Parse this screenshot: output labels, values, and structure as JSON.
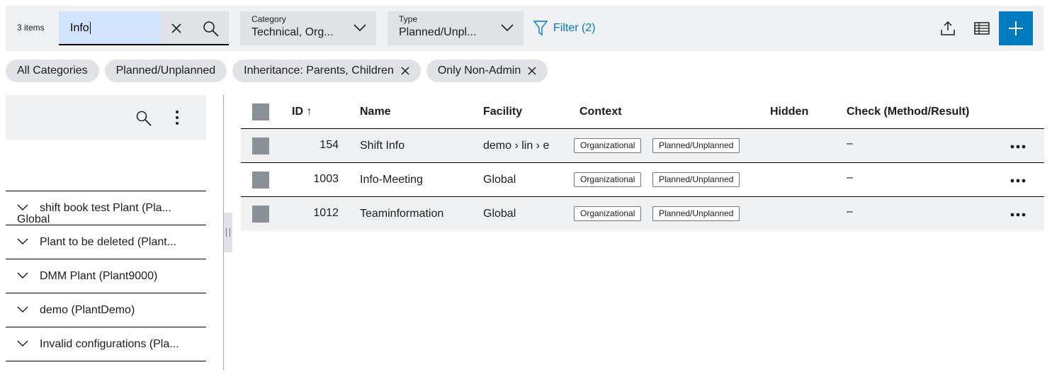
{
  "toolbar": {
    "items_count": "3 items",
    "search": {
      "value": "Info"
    },
    "category": {
      "label": "Category",
      "value": "Technical, Org..."
    },
    "type": {
      "label": "Type",
      "value": "Planned/Unpl..."
    },
    "filter_label": "Filter (2)",
    "accent_color": "#007bc0"
  },
  "chips": [
    {
      "label": "All Categories",
      "removable": false
    },
    {
      "label": "Planned/Unplanned",
      "removable": false
    },
    {
      "label": "Inheritance: Parents, Children",
      "removable": true
    },
    {
      "label": "Only Non-Admin",
      "removable": true
    }
  ],
  "left_panel": {
    "global_label": "Global",
    "items": [
      {
        "label": "shift book test Plant (Pla..."
      },
      {
        "label": "Plant to be deleted (Plant..."
      },
      {
        "label": "DMM Plant (Plant9000)"
      },
      {
        "label": "demo (PlantDemo)"
      },
      {
        "label": "Invalid configurations (Pla..."
      }
    ]
  },
  "table": {
    "columns": {
      "id": "ID",
      "id_sort": "↑",
      "name": "Name",
      "facility": "Facility",
      "context": "Context",
      "hidden": "Hidden",
      "check": "Check (Method/Result)"
    },
    "rows": [
      {
        "id": "154",
        "name": "Shift Info",
        "facility": "demo › lin › e",
        "tags": [
          "Organizational",
          "Planned/Unplanned"
        ],
        "check": "–"
      },
      {
        "id": "1003",
        "name": "Info-Meeting",
        "facility": "Global",
        "tags": [
          "Organizational",
          "Planned/Unplanned"
        ],
        "check": "–"
      },
      {
        "id": "1012",
        "name": "Teaminformation",
        "facility": "Global",
        "tags": [
          "Organizational",
          "Planned/Unplanned"
        ],
        "check": "–"
      }
    ]
  }
}
